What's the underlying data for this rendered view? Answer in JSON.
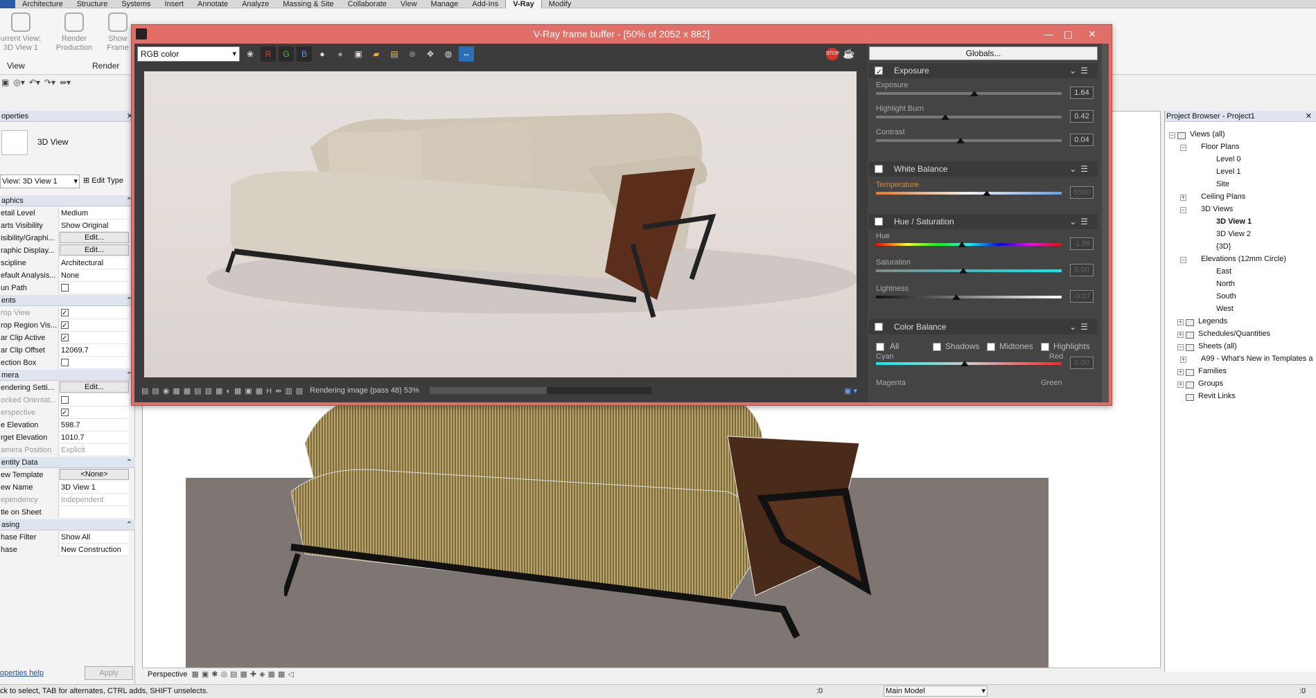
{
  "ribbon": {
    "tabs": [
      "Architecture",
      "Structure",
      "Systems",
      "Insert",
      "Annotate",
      "Analyze",
      "Massing & Site",
      "Collaborate",
      "View",
      "Manage",
      "Add-Ins",
      "V-Ray",
      "Modify"
    ],
    "active_tab": "V-Ray",
    "current_view_label": "urrent View:",
    "current_view_value": "3D View 1",
    "render_production": "Render Production",
    "show_frame": "Show Frame",
    "panel_view": "View",
    "panel_render": "Render"
  },
  "properties": {
    "title": "operties",
    "type_name": "3D View",
    "view_selector": "View: 3D View 1",
    "edit_type": "Edit Type",
    "help": "operties help",
    "apply": "Apply",
    "sections": {
      "graphics": "aphics",
      "extents": "ents",
      "camera": "mera",
      "identity": "entity Data",
      "phasing": "asing"
    },
    "rows": [
      {
        "k": "etail Level",
        "v": "Medium"
      },
      {
        "k": "arts Visibility",
        "v": "Show Original"
      },
      {
        "k": "isibility/Graphi...",
        "v": "Edit..."
      },
      {
        "k": "raphic Display...",
        "v": "Edit..."
      },
      {
        "k": "scipline",
        "v": "Architectural"
      },
      {
        "k": "efault Analysis...",
        "v": "None"
      },
      {
        "k": "un Path",
        "v": ""
      },
      {
        "k": "rop View",
        "v": ""
      },
      {
        "k": "rop Region Vis...",
        "v": ""
      },
      {
        "k": "ar Clip Active",
        "v": ""
      },
      {
        "k": "ar Clip Offset",
        "v": "12069.7"
      },
      {
        "k": "ection Box",
        "v": ""
      },
      {
        "k": "endering Setti...",
        "v": "Edit..."
      },
      {
        "k": "ocked Orientat...",
        "v": ""
      },
      {
        "k": "erspective",
        "v": ""
      },
      {
        "k": "e Elevation",
        "v": "598.7"
      },
      {
        "k": "rget Elevation",
        "v": "1010.7"
      },
      {
        "k": "amera Position",
        "v": "Explicit"
      },
      {
        "k": "ew Template",
        "v": "<None>"
      },
      {
        "k": "ew Name",
        "v": "3D View 1"
      },
      {
        "k": "ependency",
        "v": "Independent"
      },
      {
        "k": "tle on Sheet",
        "v": ""
      },
      {
        "k": "hase Filter",
        "v": "Show All"
      },
      {
        "k": "hase",
        "v": "New Construction"
      }
    ]
  },
  "vfb": {
    "title": "V-Ray frame buffer - [50% of 2052 x 882]",
    "channel": "RGB color",
    "r": "R",
    "g": "G",
    "b": "B",
    "globals": "Globals...",
    "status": "Rendering image (pass 48) 53%",
    "progress": 0.53,
    "exposure": {
      "title": "Exposure",
      "exposure_label": "Exposure",
      "exposure_value": "1.64",
      "burn_label": "Highlight Burn",
      "burn_value": "0.42",
      "contrast_label": "Contrast",
      "contrast_value": "0.04"
    },
    "white_balance": {
      "title": "White Balance",
      "temperature_label": "Temperature",
      "temperature_value": "6500"
    },
    "hue_sat": {
      "title": "Hue / Saturation",
      "hue_label": "Hue",
      "hue_value": "-1.89",
      "sat_label": "Saturation",
      "sat_value": "0.00",
      "light_label": "Lightness",
      "light_value": "-0.07"
    },
    "color_balance": {
      "title": "Color Balance",
      "all": "All",
      "shadows": "Shadows",
      "midtones": "Midtones",
      "highlights": "Highlights",
      "cyan": "Cyan",
      "red": "Red",
      "magenta": "Magenta",
      "green": "Green",
      "cb_value": "0.00"
    }
  },
  "viewport": {
    "view_style": "Perspective"
  },
  "browser": {
    "title": "Project Browser - Project1",
    "nodes": [
      "Views (all)",
      "Floor Plans",
      "Level 0",
      "Level 1",
      "Site",
      "Ceiling Plans",
      "3D Views",
      "3D View 1",
      "3D View 2",
      "{3D}",
      "Elevations (12mm Circle)",
      "East",
      "North",
      "South",
      "West",
      "Legends",
      "Schedules/Quantities",
      "Sheets (all)",
      "A99 - What's New in Templates a",
      "Families",
      "Groups",
      "Revit Links"
    ]
  },
  "status": {
    "hint": "ck to select, TAB for alternates, CTRL adds, SHIFT unselects.",
    "coord": ":0",
    "model": "Main Model",
    "filter": ":0"
  }
}
